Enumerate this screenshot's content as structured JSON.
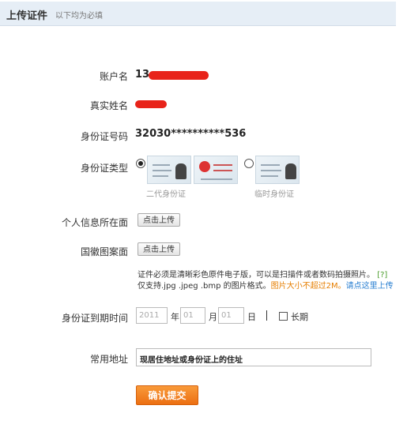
{
  "header": {
    "title": "上传证件",
    "subtitle": "以下均为必填"
  },
  "form": {
    "account_label": "账户名",
    "account_value": "13",
    "realname_label": "真实姓名",
    "idno_label": "身份证号码",
    "idno_value": "32030**********536",
    "idtype_label": "身份证类型",
    "idtype_options": [
      {
        "label": "二代身份证",
        "selected": true
      },
      {
        "label": "临时身份证",
        "selected": false
      }
    ],
    "info_side_label": "个人信息所在面",
    "emblem_side_label": "国徽图案面",
    "upload_button": "点击上传",
    "note_line1": "证件必须是清晰彩色原件电子版，可以是扫描件或者数码拍摄照片。",
    "note_help": "[?]",
    "note_line2": "仅支持.jpg .jpeg .bmp 的图片格式。",
    "note_size": "图片大小不超过2M。",
    "note_link": "请点这里上传",
    "expiry_label": "身份证到期时间",
    "expiry_year_placeholder": "2011",
    "expiry_month_placeholder": "01",
    "expiry_day_placeholder": "01",
    "year_unit": "年",
    "month_unit": "月",
    "day_unit": "日",
    "longterm_label": "长期",
    "address_label": "常用地址",
    "address_value": "现居住地址或身份证上的住址",
    "submit_label": "确认提交"
  },
  "colors": {
    "header_bg": "#e6eef6",
    "submit": "#ec6f12",
    "redaction": "#e8231a"
  }
}
